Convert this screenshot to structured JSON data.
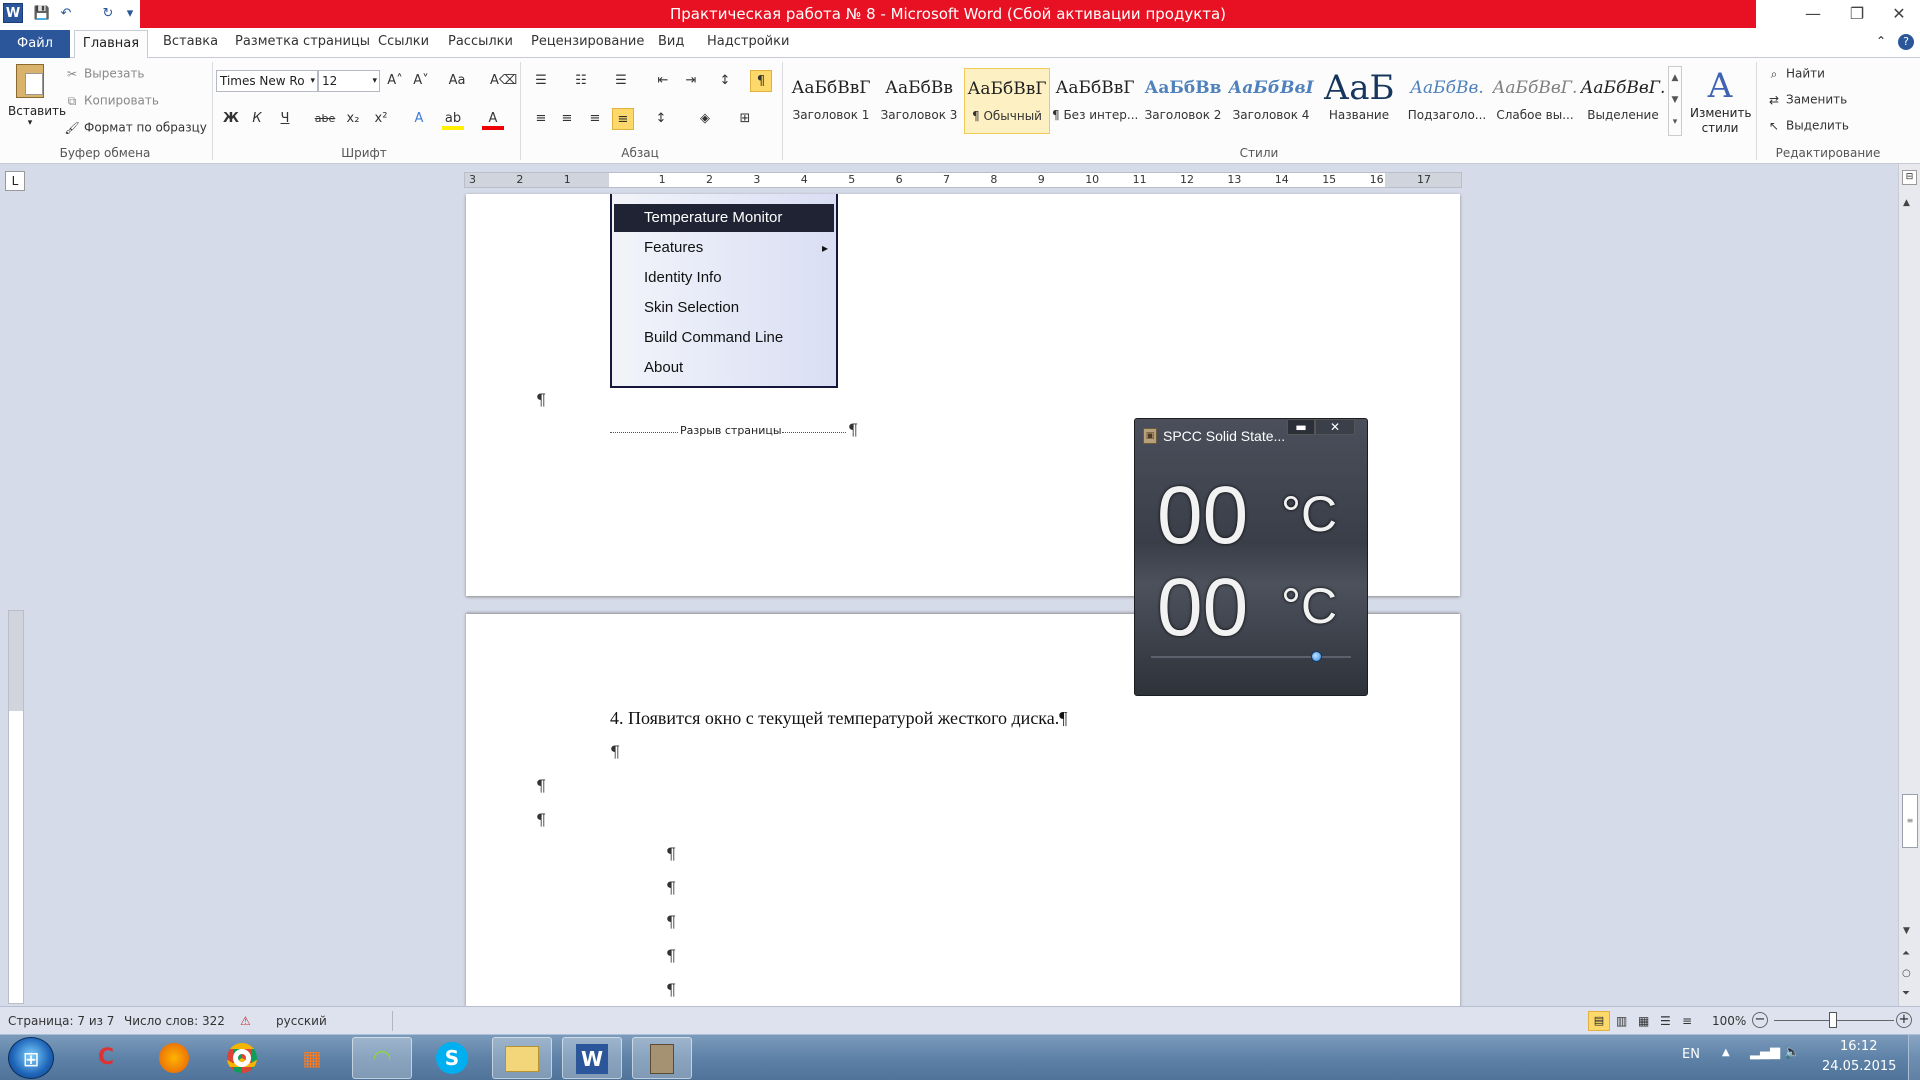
{
  "window": {
    "title": "Практическая работа № 8  -  Microsoft Word (Сбой активации продукта)",
    "logo": "W",
    "min": "—",
    "restore": "❐",
    "close": "✕"
  },
  "qat": {
    "save": "💾",
    "undo": "↶",
    "redo": "↻",
    "more": "▾"
  },
  "tabs": {
    "file": "Файл",
    "home": "Главная",
    "items": [
      "Вставка",
      "Разметка страницы",
      "Ссылки",
      "Рассылки",
      "Рецензирование",
      "Вид",
      "Надстройки"
    ]
  },
  "ribbon": {
    "clipboard": {
      "label": "Буфер обмена",
      "paste": "Вставить",
      "cut": "Вырезать",
      "copy": "Копировать",
      "format_painter": "Формат по образцу"
    },
    "font": {
      "label": "Шрифт",
      "name": "Times New Ro",
      "size": "12",
      "grow": "A˄",
      "shrink": "A˅",
      "case": "Aa",
      "clear": "A⌫",
      "bold": "Ж",
      "italic": "К",
      "underline": "Ч",
      "strike": "abe",
      "sub": "x₂",
      "sup": "x²",
      "effects": "A",
      "highlight": "ab",
      "color": "A"
    },
    "paragraph": {
      "label": "Абзац",
      "show_marks": "¶"
    },
    "styles": {
      "label": "Стили",
      "items": [
        {
          "sample": "АаБбВвГ",
          "name": "Заголовок 1"
        },
        {
          "sample": "АаБбВв",
          "name": "Заголовок 3"
        },
        {
          "sample": "АаБбВвГ",
          "name": "¶ Обычный"
        },
        {
          "sample": "АаБбВвГ",
          "name": "¶ Без интер..."
        },
        {
          "sample": "АаБбВв",
          "name": "Заголовок 2"
        },
        {
          "sample": "АаБбВвІ",
          "name": "Заголовок 4"
        },
        {
          "sample": "АаБ",
          "name": "Название"
        },
        {
          "sample": "АаБбВв.",
          "name": "Подзаголо..."
        },
        {
          "sample": "АаБбВвГ.",
          "name": "Слабое вы..."
        },
        {
          "sample": "АаБбВвГ.",
          "name": "Выделение"
        }
      ],
      "change": "Изменить стили"
    },
    "editing": {
      "label": "Редактирование",
      "find": "Найти",
      "replace": "Заменить",
      "select": "Выделить"
    }
  },
  "ruler": {
    "numbers": [
      "3",
      "2",
      "1",
      "",
      "1",
      "2",
      "3",
      "4",
      "5",
      "6",
      "7",
      "8",
      "9",
      "10",
      "11",
      "12",
      "13",
      "14",
      "15",
      "16",
      "17"
    ],
    "tab_selector": "L"
  },
  "document": {
    "page_break": "Разрыв страницы",
    "pilcrow": "¶",
    "step4": "4. Появится окно с текущей температурой жесткого диска.¶"
  },
  "context_menu": {
    "items": [
      "Temperature Monitor",
      "Features",
      "Identity Info",
      "Skin Selection",
      "Build Command Line",
      "About"
    ],
    "arrow": "▸"
  },
  "widget": {
    "title": "SPCC Solid State...",
    "temp1": "00",
    "temp2": "00",
    "unit": "°C",
    "min_btn": "▬",
    "close_btn": "✕",
    "slider_value": 0.83
  },
  "status": {
    "page": "Страница: 7 из 7",
    "words": "Число слов: 322",
    "lang": "русский",
    "zoom": "100%",
    "zoom_minus": "−",
    "zoom_plus": "+"
  },
  "taskbar": {
    "apps": [
      "ccleaner-icon",
      "firefox-icon",
      "chrome-icon",
      "apps-icon",
      "network-app-icon",
      "skype-icon",
      "explorer-icon",
      "word-icon",
      "disk-monitor-icon"
    ],
    "lang": "EN",
    "time": "16:12",
    "date": "24.05.2015"
  }
}
